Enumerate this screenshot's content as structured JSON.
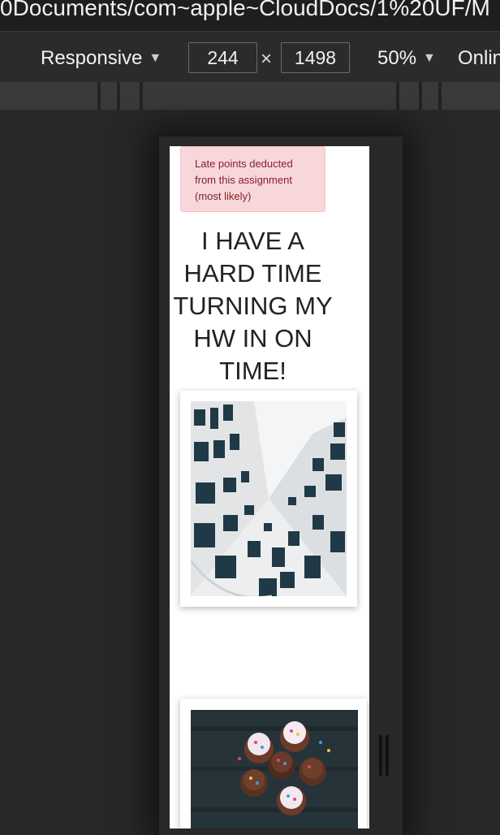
{
  "browser": {
    "url_fragment": "0Documents/com~apple~CloudDocs/1%20UF/M"
  },
  "device_toolbar": {
    "mode": "Responsive",
    "width": "244",
    "times": "×",
    "height": "1498",
    "zoom": "50%",
    "throttle": "Onlin"
  },
  "page": {
    "alert_text": "Late points deducted from this assignment (most likely)",
    "heading": "I HAVE A HARD TIME TURNING MY HW IN ON TIME!"
  },
  "colors": {
    "alert_bg": "#f8d7da",
    "alert_text": "#842029",
    "devtools_bg": "#282828"
  }
}
